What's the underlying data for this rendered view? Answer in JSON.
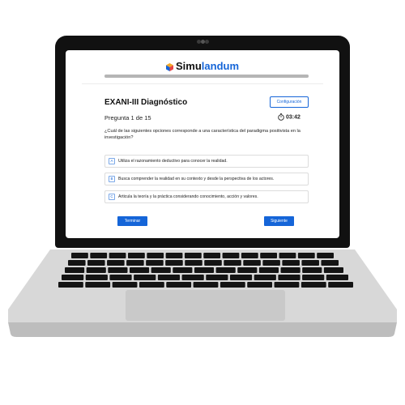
{
  "brand": {
    "name_part1": "Simu",
    "name_part2": "landum",
    "accent": "#1565d8"
  },
  "progress": {
    "fraction": 1.0
  },
  "exam": {
    "title": "EXANI-III Diagnóstico",
    "config_label": "Configuración"
  },
  "status": {
    "question_counter": "Pregunta 1 de 15",
    "timer": "03:42",
    "timer_icon": "stopwatch-icon"
  },
  "question": {
    "text": "¿Cuál de las siguientes opciones corresponde a una característica del paradigma positivista en la investigación?"
  },
  "options": [
    {
      "letter": "A",
      "text": "Utiliza el razonamiento deductivo para conocer la realidad."
    },
    {
      "letter": "B",
      "text": "Busca comprender la realidad en su contexto y desde la perspectiva de los actores."
    },
    {
      "letter": "C",
      "text": "Articula la teoría y la práctica considerando conocimiento, acción y valores."
    }
  ],
  "nav": {
    "finish_label": "Terminar",
    "next_label": "Siguiente"
  }
}
